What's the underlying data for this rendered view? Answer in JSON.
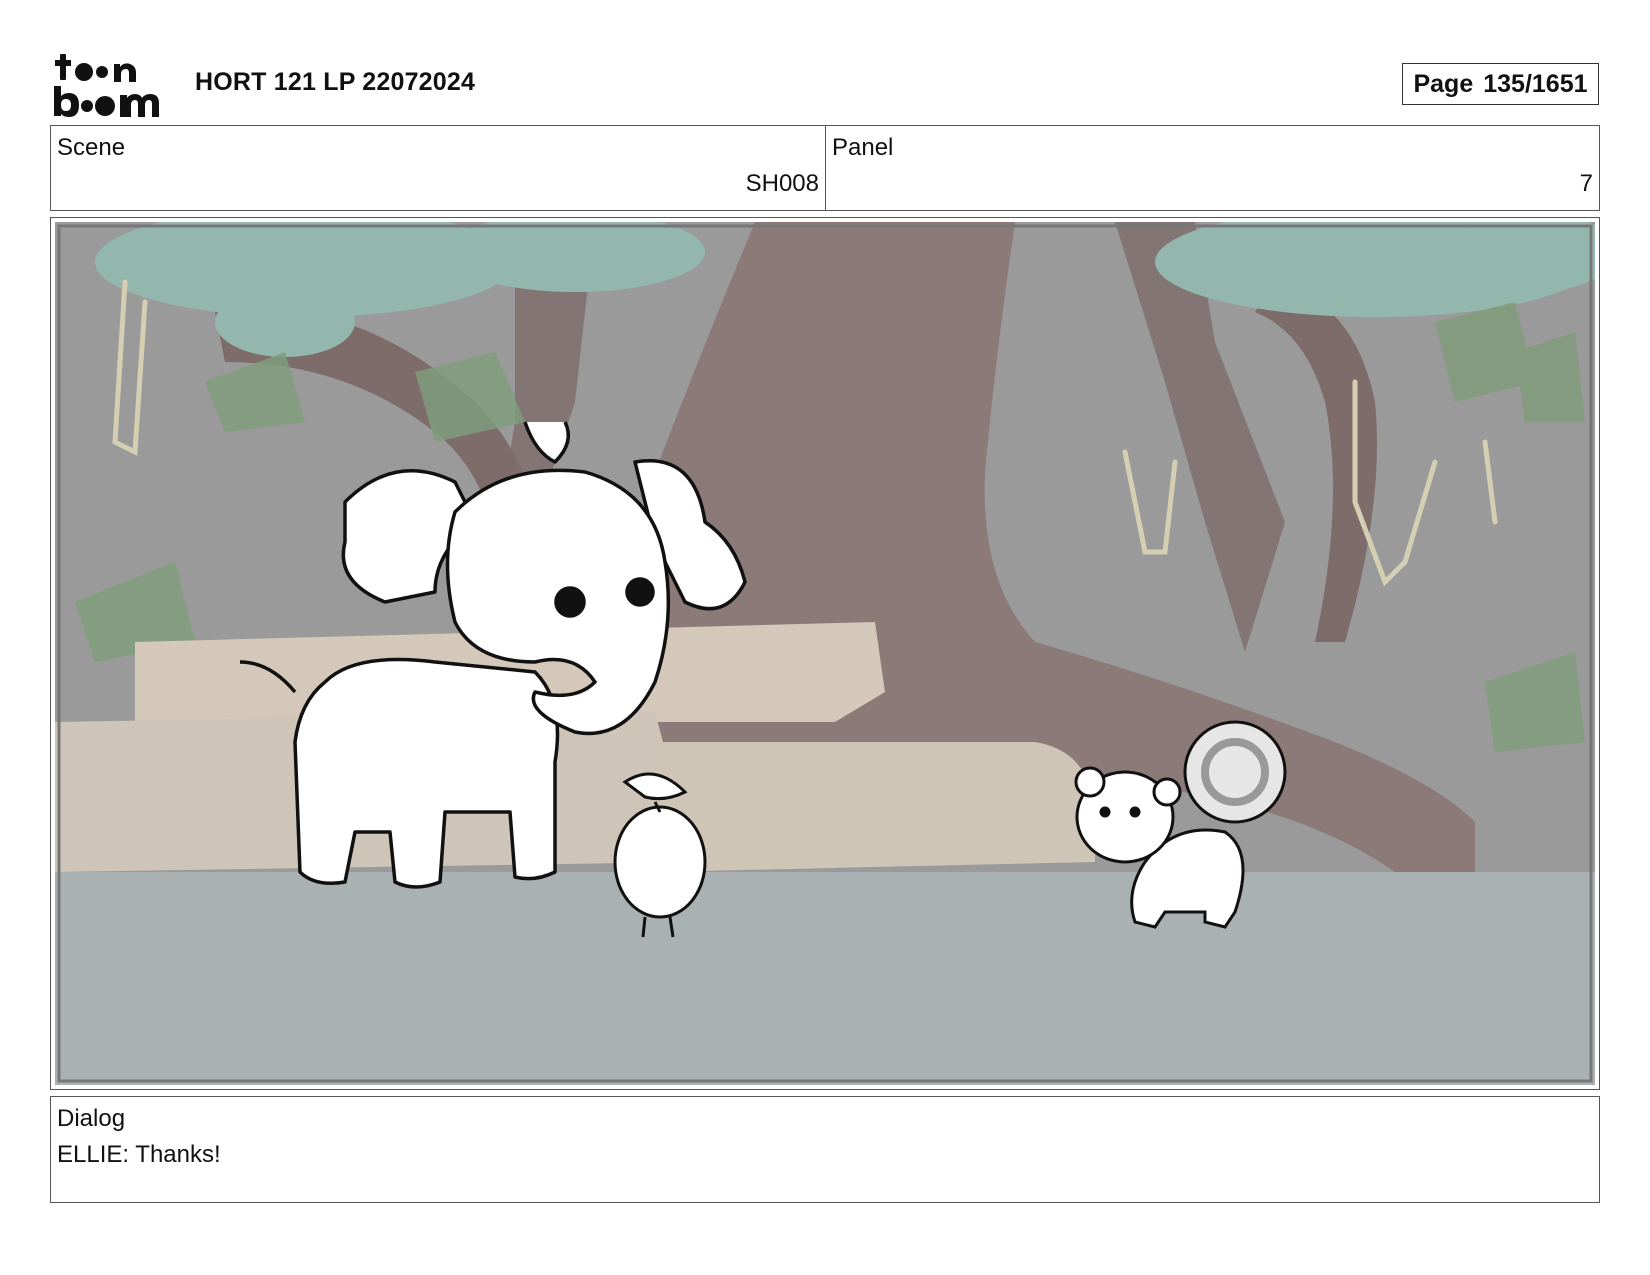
{
  "header": {
    "brand": "toonboom",
    "title": "HORT 121 LP 22072024",
    "page_label": "Page",
    "page_value": "135/1651"
  },
  "scene": {
    "label": "Scene",
    "value": "SH008"
  },
  "panel": {
    "label": "Panel",
    "value": "7"
  },
  "dialog": {
    "label": "Dialog",
    "text": "ELLIE: Thanks!"
  },
  "colors": {
    "sky": "#8f8f8f",
    "foliage": "#7fa89a",
    "trunk": "#6e5a58",
    "rock": "#cfc3b4",
    "ground": "#a9b0b2"
  }
}
